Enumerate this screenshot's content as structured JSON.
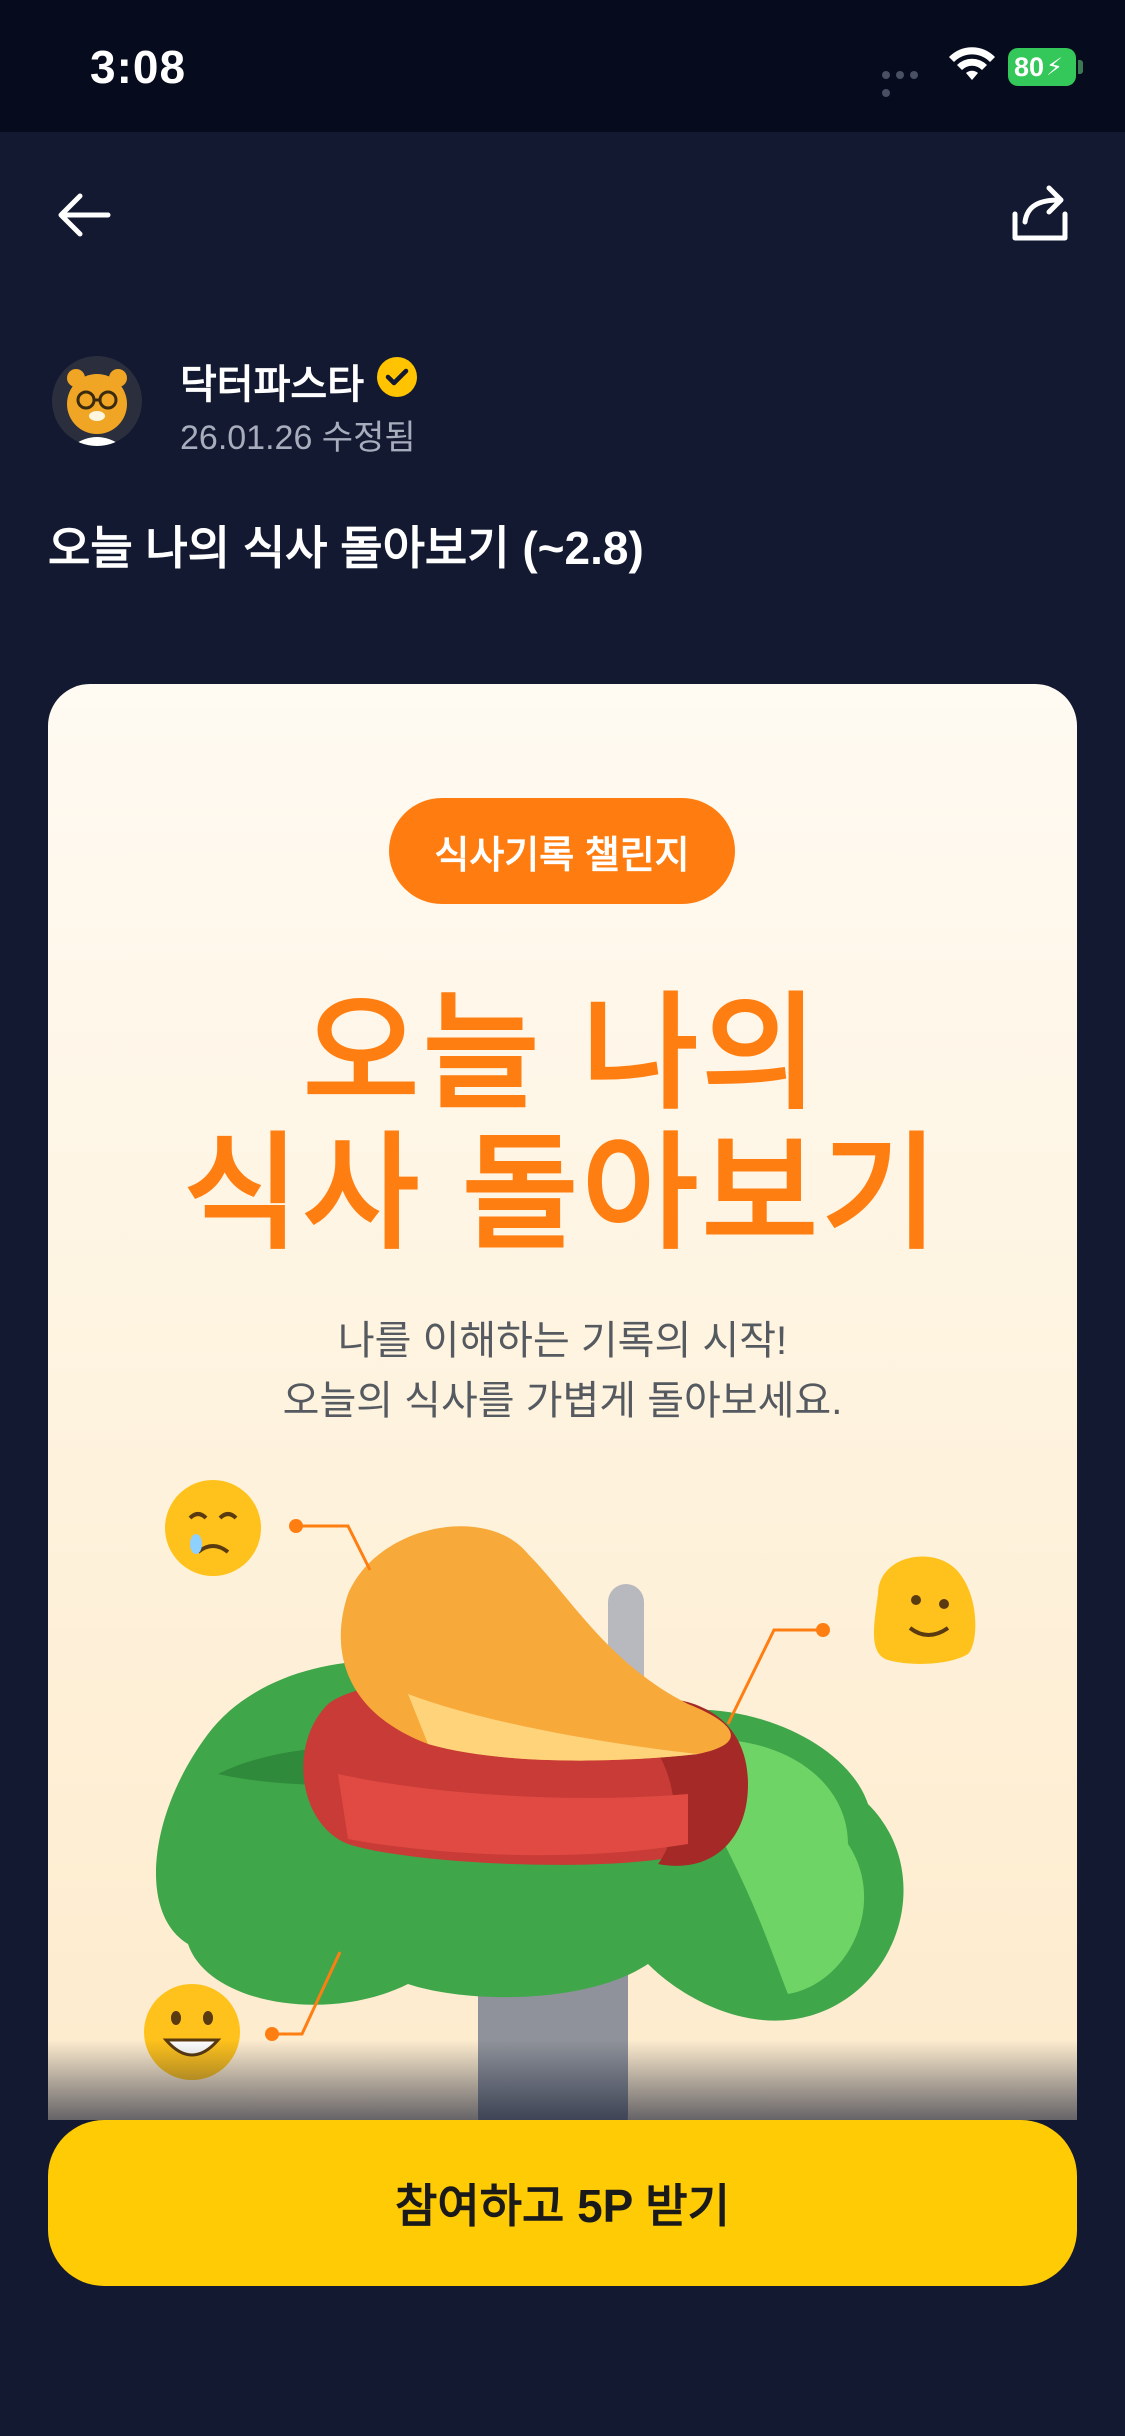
{
  "status_bar": {
    "time": "3:08",
    "battery": "80"
  },
  "header": {
    "back_icon": "arrow-left-icon",
    "share_icon": "share-icon"
  },
  "post": {
    "author": "닥터파스타",
    "date": "26.01.26 수정됨",
    "title": "오늘 나의 식사 돌아보기 (~2.8)"
  },
  "card": {
    "badge": "식사기록 챌린지",
    "headline_line1": "오늘 나의",
    "headline_line2": "식사 돌아보기",
    "subtitle_line1": "나를 이해하는 기록의 시작!",
    "subtitle_line2": "오늘의 식사를 가볍게 돌아보세요."
  },
  "cta": {
    "label": "참여하고 5P 받기"
  },
  "colors": {
    "accent": "#ff7e12",
    "cta": "#ffcb05",
    "background": "#121930"
  }
}
